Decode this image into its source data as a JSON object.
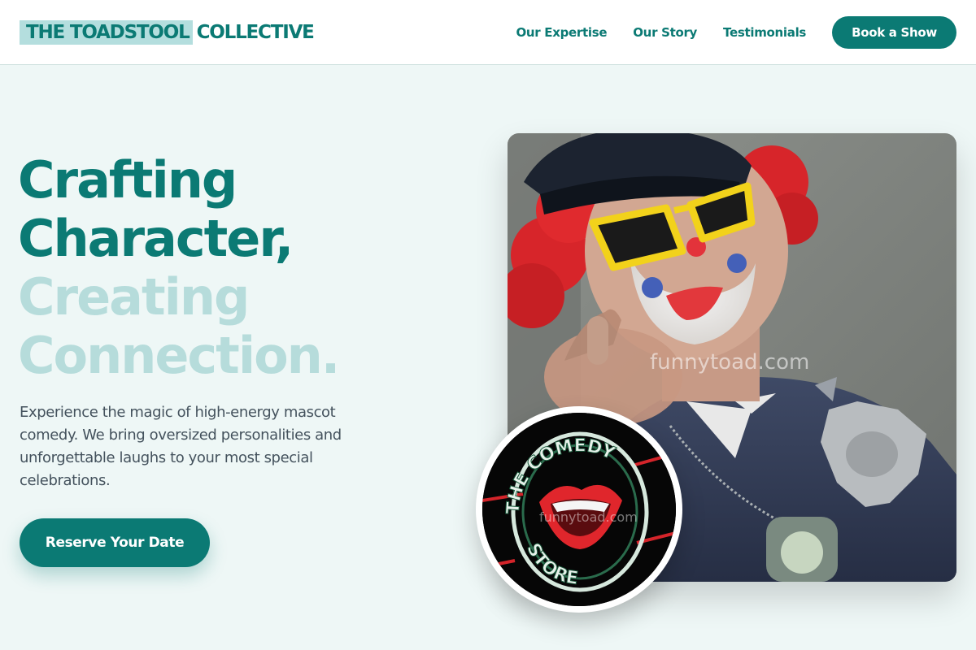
{
  "brand": {
    "highlight": "THE TOADSTOOL",
    "rest": "COLLECTIVE"
  },
  "nav": {
    "links": [
      "Our Expertise",
      "Our Story",
      "Testimonials"
    ],
    "cta": "Book a Show"
  },
  "hero": {
    "title_lines": [
      "Crafting",
      "Character,",
      "Creating",
      "Connection."
    ],
    "description": "Experience the magic of high-energy mascot comedy. We bring oversized personalities and unforgettable laughs to your most special celebrations.",
    "cta": "Reserve Your Date"
  },
  "images": {
    "photo_watermark": "funnytoad.com",
    "badge_sign_top": "THE COMEDY",
    "badge_sign_bottom": "STORE",
    "badge_watermark": "funnytoad.com"
  },
  "colors": {
    "accent": "#0b7a74",
    "accent_light": "#b6dcdb",
    "brand_highlight_bg": "#b4dede",
    "page_bg": "#eef7f6",
    "body_text": "#44525d"
  }
}
